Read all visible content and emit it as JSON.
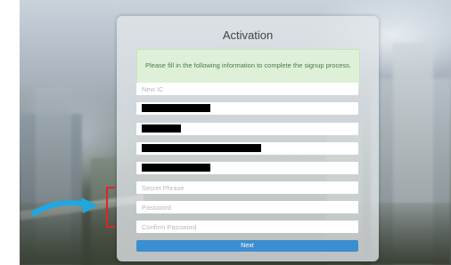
{
  "panel": {
    "title": "Activation",
    "notice": "Please fill in the following information to complete the signup process.",
    "fields": {
      "new_ic_placeholder": "New IC",
      "secret_phrase_placeholder": "Secret Phrase",
      "password_placeholder": "Password",
      "confirm_password_placeholder": "Confirm Password"
    },
    "next_label": "Next"
  },
  "colors": {
    "notice_bg": "#dff0d8",
    "notice_text": "#4a7a4a",
    "button_bg": "#3b8ed0",
    "annotation_bracket": "#e02424",
    "annotation_arrow": "#1fa8e0"
  },
  "icons": {
    "annotation_arrow": "arrow-right-icon"
  }
}
